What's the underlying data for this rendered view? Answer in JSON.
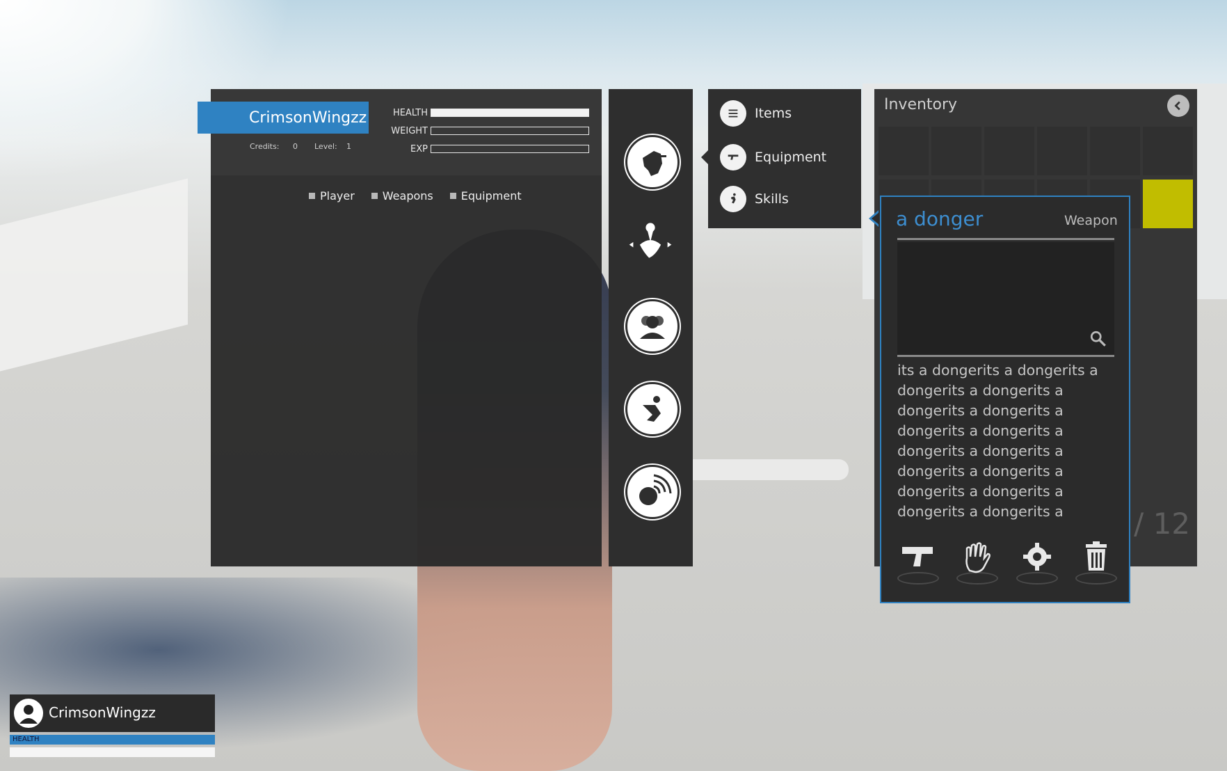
{
  "character": {
    "name": "CrimsonWingzz",
    "credits_label": "Credits:",
    "credits_value": "0",
    "level_label": "Level:",
    "level_value": "1",
    "stats": [
      {
        "label": "HEALTH",
        "fill": 1.0
      },
      {
        "label": "WEIGHT",
        "fill": 0.0
      },
      {
        "label": "EXP",
        "fill": 0.0
      }
    ],
    "tabs": [
      "Player",
      "Weapons",
      "Equipment"
    ]
  },
  "nav": {
    "icons": [
      "soldier-icon",
      "map-pin-icon",
      "group-icon",
      "runner-icon",
      "globe-signal-icon"
    ]
  },
  "menu": {
    "items": [
      {
        "label": "Items",
        "icon": "list-icon"
      },
      {
        "label": "Equipment",
        "icon": "pistol-icon"
      },
      {
        "label": "Skills",
        "icon": "runner-icon"
      }
    ]
  },
  "inventory": {
    "title": "Inventory",
    "counter": "2 / 12",
    "selected_color": "#c1bd00"
  },
  "tooltip": {
    "name": "a donger",
    "type": "Weapon",
    "description": "its a dongerits a dongerits a dongerits a dongerits a dongerits a dongerits a dongerits a dongerits a dongerits a dongerits a dongerits a dongerits a dongerits a dongerits a dongerits a dongerits a dongerits a dongerits",
    "actions": [
      "equip-pistol-icon",
      "grab-hand-icon",
      "settings-gear-icon",
      "trash-icon"
    ]
  },
  "hud": {
    "name": "CrimsonWingzz",
    "health_label": "HEALTH",
    "health_fill": 1.0
  },
  "colors": {
    "accent": "#2f82c2",
    "panel": "#363636",
    "selected": "#c1bd00"
  }
}
